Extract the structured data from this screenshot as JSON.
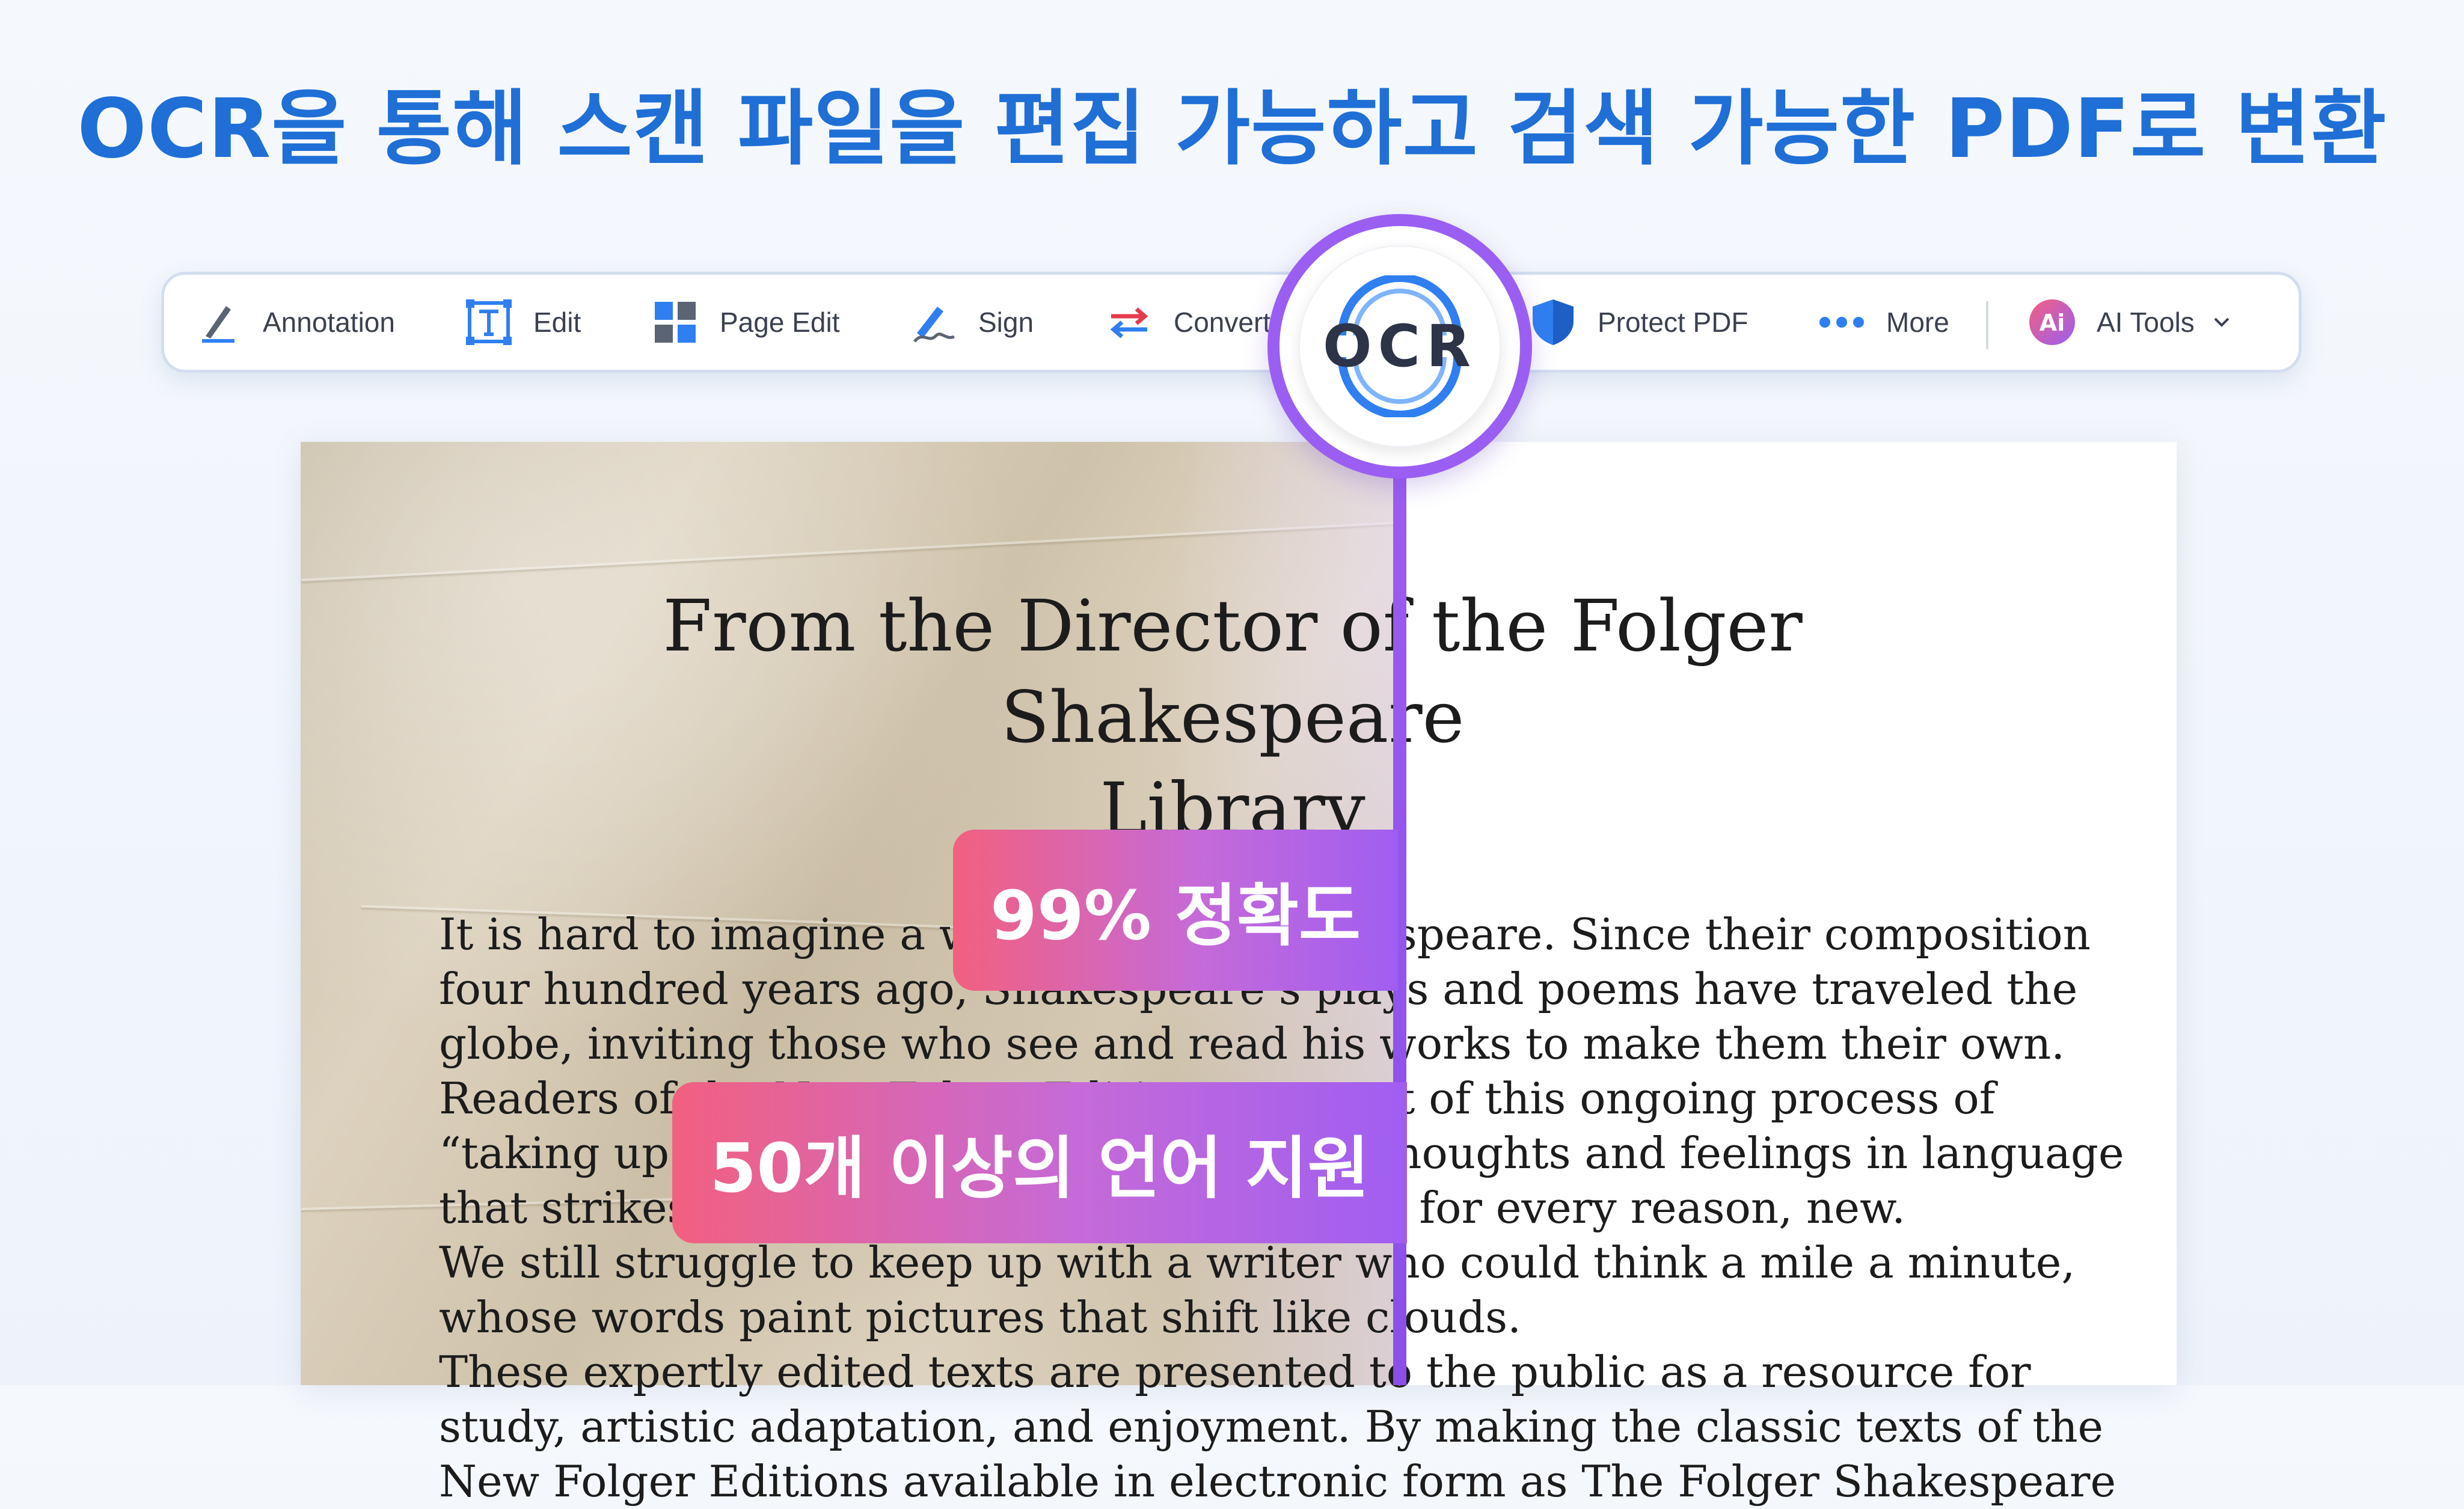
{
  "headline": "OCR을 통해 스캔 파일을 편집 가능하고 검색 가능한 PDF로 변환",
  "toolbar": {
    "items": [
      {
        "label": "Annotation",
        "icon": "pen-icon"
      },
      {
        "label": "Edit",
        "icon": "text-edit-icon"
      },
      {
        "label": "Page Edit",
        "icon": "grid-icon"
      },
      {
        "label": "Sign",
        "icon": "signature-icon"
      },
      {
        "label": "Convert",
        "icon": "convert-arrows-icon"
      },
      {
        "label": "Protect PDF",
        "icon": "shield-icon"
      },
      {
        "label": "More",
        "icon": "more-dots-icon"
      },
      {
        "label": "AI Tools",
        "icon": "ai-icon"
      }
    ],
    "ai_badge": "Ai"
  },
  "ocr_badge": "OCR",
  "document": {
    "title_line1": "From the Director of the Folger Shakespeare",
    "title_line2": "Library",
    "lines": [
      "It is hard to imagine a world without Shakespeare. Since their composition",
      "four hundred years ago, Shakespeare’s plays and poems have traveled the",
      "globe, inviting those who see and read his works to make them their own.",
      "Readers of the New Folger Editions are part of this ongoing process of",
      "“taking up Shakespeare,” finding our own thoughts and feelings in language",
      "that strikes us as old or even alien, yet also, for every reason, new.",
      "We still struggle to keep up with a writer who could think a mile a minute,",
      "whose words paint pictures that shift like clouds.",
      "These expertly edited texts are presented to the public as a resource for",
      "study, artistic adaptation, and enjoyment. By making the classic texts of the",
      "New Folger Editions available in electronic form as The Folger Shakespeare"
    ]
  },
  "badges": {
    "accuracy": "99% 정확도",
    "languages": "50개 이상의 언어 지원"
  },
  "colors": {
    "headline": "#1f6fd6",
    "accent_purple": "#9b5ef2",
    "badge_pink": "#f2607f",
    "ocr_blue": "#2f7ff0"
  }
}
